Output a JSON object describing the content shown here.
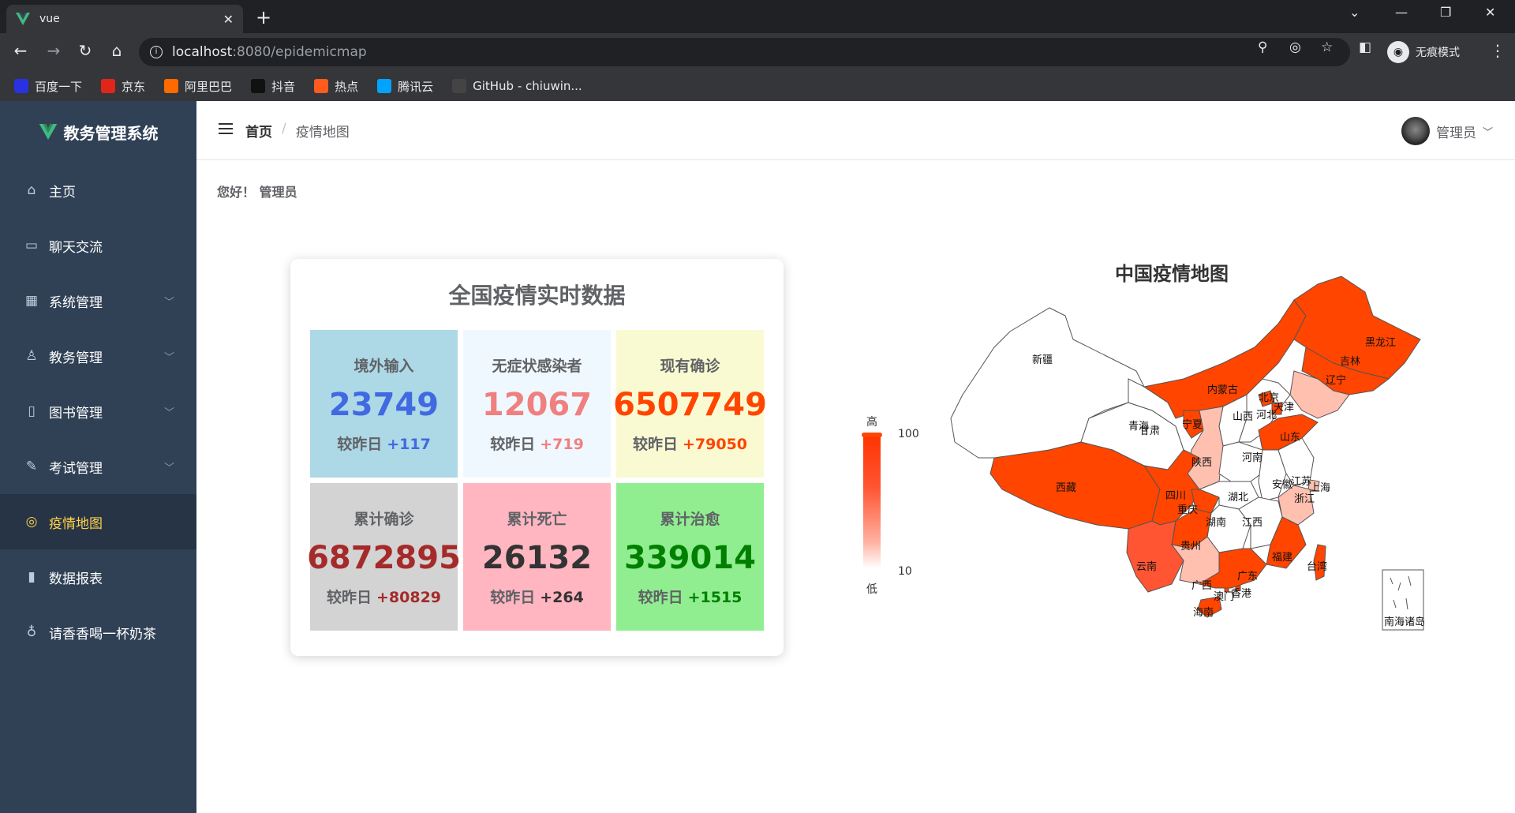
{
  "browser": {
    "tab_title": "vue",
    "url_host": "localhost",
    "url_rest": ":8080/epidemicmap",
    "incognito_label": "无痕模式",
    "bookmarks": [
      {
        "label": "百度一下",
        "icon": "baidu-icon",
        "color": "#2932e1"
      },
      {
        "label": "京东",
        "icon": "jd-icon",
        "color": "#e1251b"
      },
      {
        "label": "阿里巴巴",
        "icon": "alibaba-icon",
        "color": "#ff6a00"
      },
      {
        "label": "抖音",
        "icon": "douyin-icon",
        "color": "#111111"
      },
      {
        "label": "热点",
        "icon": "hot-icon",
        "color": "#ff5a1f"
      },
      {
        "label": "腾讯云",
        "icon": "tencent-cloud-icon",
        "color": "#00a4ff"
      },
      {
        "label": "GitHub - chiuwin...",
        "icon": "github-icon",
        "color": "#444444"
      }
    ]
  },
  "sidebar": {
    "brand": "教务管理系统",
    "items": [
      {
        "label": "主页",
        "icon": "home-icon",
        "arrow": false
      },
      {
        "label": "聊天交流",
        "icon": "chat-icon",
        "arrow": false
      },
      {
        "label": "系统管理",
        "icon": "grid-icon",
        "arrow": true
      },
      {
        "label": "教务管理",
        "icon": "user-icon",
        "arrow": true
      },
      {
        "label": "图书管理",
        "icon": "book-icon",
        "arrow": true
      },
      {
        "label": "考试管理",
        "icon": "edit-icon",
        "arrow": true
      },
      {
        "label": "疫情地图",
        "icon": "target-icon",
        "arrow": false,
        "active": true
      },
      {
        "label": "数据报表",
        "icon": "chart-icon",
        "arrow": false
      },
      {
        "label": "请香香喝一杯奶茶",
        "icon": "cup-icon",
        "arrow": false
      }
    ],
    "active_color": "#ffd04b"
  },
  "header": {
    "breadcrumb_home": "首页",
    "breadcrumb_sep": "/",
    "breadcrumb_current": "疫情地图",
    "user_name": "管理员"
  },
  "greeting": "您好！ 管理员",
  "stats": {
    "title": "全国疫情实时数据",
    "diff_prefix": "较昨日",
    "cells": [
      {
        "label": "境外输入",
        "value": "23749",
        "diff": "+117",
        "bg": "#add8e6",
        "color": "#4169e1"
      },
      {
        "label": "无症状感染者",
        "value": "12067",
        "diff": "+719",
        "bg": "#f0f8ff",
        "color": "#f08080"
      },
      {
        "label": "现有确诊",
        "value": "6507749",
        "diff": "+79050",
        "bg": "#fafad2",
        "color": "#ff4500"
      },
      {
        "label": "累计确诊",
        "value": "6872895",
        "diff": "+80829",
        "bg": "#d3d3d3",
        "color": "#a52a2a"
      },
      {
        "label": "累计死亡",
        "value": "26132",
        "diff": "+264",
        "bg": "#ffb6c1",
        "color": "#333333"
      },
      {
        "label": "累计治愈",
        "value": "339014",
        "diff": "+1515",
        "bg": "#90ee90",
        "color": "#008000"
      }
    ]
  },
  "map": {
    "title": "中国疫情地图",
    "visual_map": {
      "high_label": "高",
      "low_label": "低",
      "max": "100",
      "min": "10"
    },
    "inset_label": "南海诸岛",
    "colors": {
      "high": "#ff4500",
      "mid": "#ffc0b0",
      "low": "#ffffff"
    },
    "provinces": [
      "新疆",
      "西藏",
      "青海",
      "甘肃",
      "宁夏",
      "内蒙古",
      "黑龙江",
      "吉林",
      "辽宁",
      "北京",
      "天津",
      "河北",
      "山西",
      "山东",
      "陕西",
      "河南",
      "四川",
      "重庆",
      "湖北",
      "安徽",
      "江苏",
      "上海",
      "浙江",
      "湖南",
      "江西",
      "福建",
      "台湾",
      "云南",
      "贵州",
      "广西",
      "广东",
      "澳门",
      "香港",
      "海南"
    ]
  }
}
